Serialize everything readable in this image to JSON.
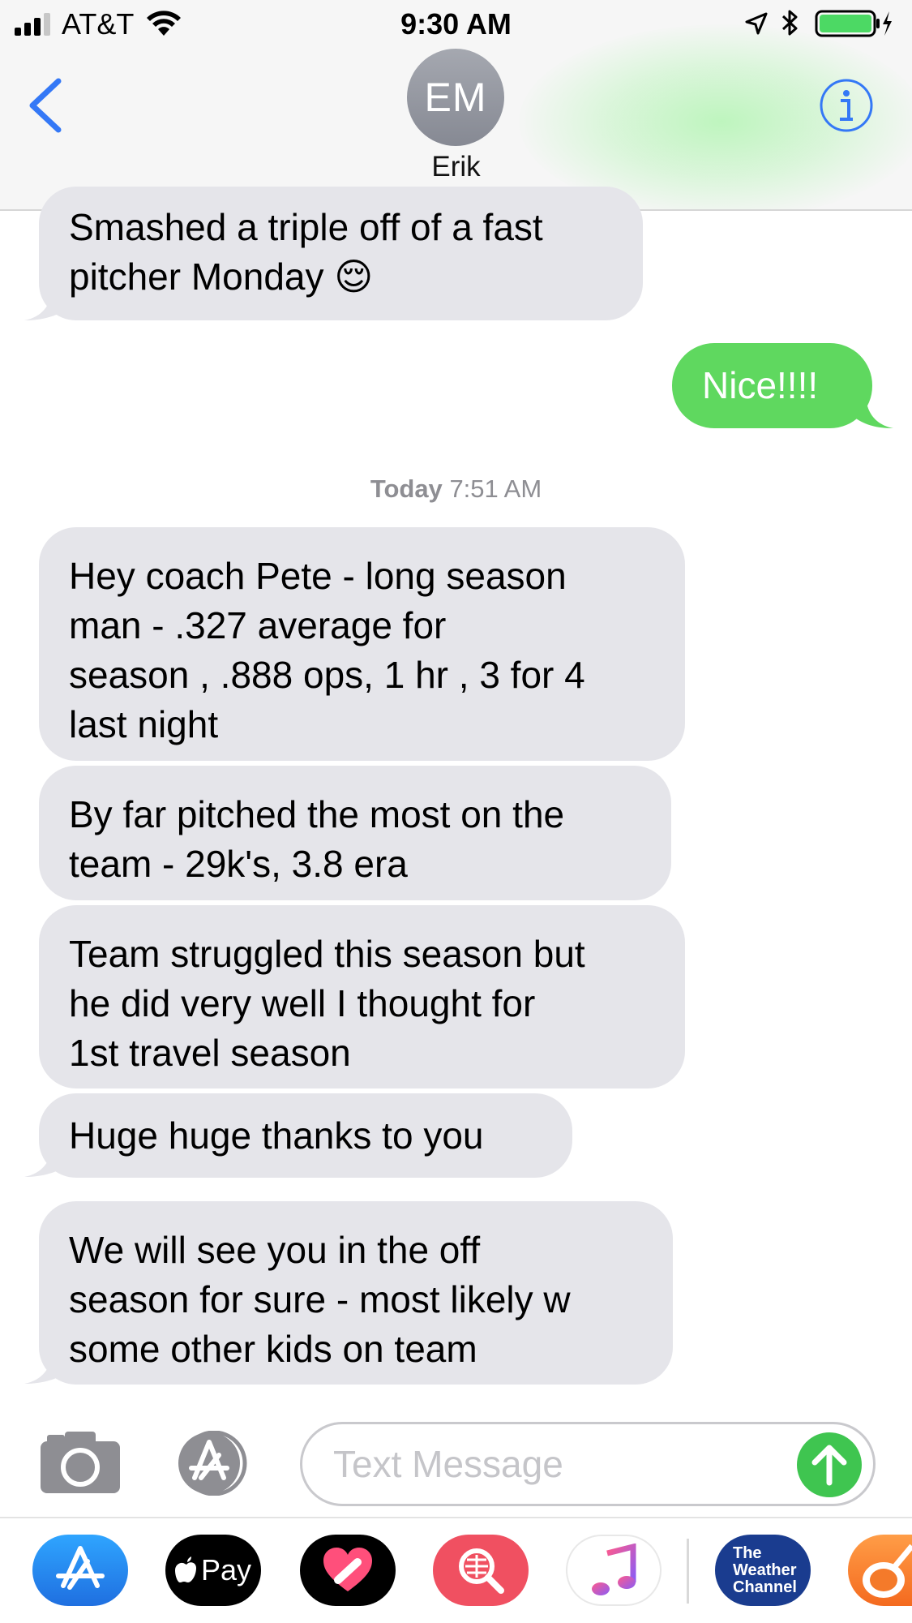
{
  "status_bar": {
    "carrier": "AT&T",
    "time": "9:30 AM"
  },
  "header": {
    "back_icon": "chevron-left-icon",
    "avatar_initials": "EM",
    "contact_name": "Erik",
    "info_icon": "info-circle-icon"
  },
  "messages": [
    {
      "direction": "received",
      "text": "Smashed a triple off of a fast\npitcher Monday 😌"
    },
    {
      "direction": "sent",
      "text": "Nice!!!!"
    },
    {
      "direction": "received",
      "text": "Hey coach Pete - long season\nman - .327 average for\nseason , .888 ops, 1 hr , 3 for 4\nlast night"
    },
    {
      "direction": "received",
      "text": "By far pitched the most on the\nteam - 29k's, 3.8 era"
    },
    {
      "direction": "received",
      "text": "Team struggled this season but\nhe did very well I thought for\n1st travel season"
    },
    {
      "direction": "received",
      "text": "Huge huge thanks to you"
    },
    {
      "direction": "received",
      "text": "We will see you in the off\nseason for sure - most likely w\nsome other kids on team"
    }
  ],
  "timestamp": {
    "day": "Today",
    "time": "7:51 AM"
  },
  "composer": {
    "camera_icon": "camera-icon",
    "apps_icon": "app-store-icon",
    "placeholder": "Text Message",
    "send_icon": "arrow-up-icon"
  },
  "app_drawer": [
    {
      "name": "app-store-icon"
    },
    {
      "name": "apple-pay-icon",
      "label": "Pay"
    },
    {
      "name": "digital-touch-icon"
    },
    {
      "name": "images-search-icon"
    },
    {
      "name": "music-icon"
    },
    {
      "name": "weather-channel-icon",
      "label_lines": [
        "The",
        "Weather",
        "Channel"
      ]
    },
    {
      "name": "garageband-icon"
    }
  ],
  "colors": {
    "ios_blue": "#3478f6",
    "sent_bubble": "#5fd85f",
    "received_bubble": "#e5e5ea",
    "send_button": "#3fc550",
    "battery": "#4cd964"
  }
}
